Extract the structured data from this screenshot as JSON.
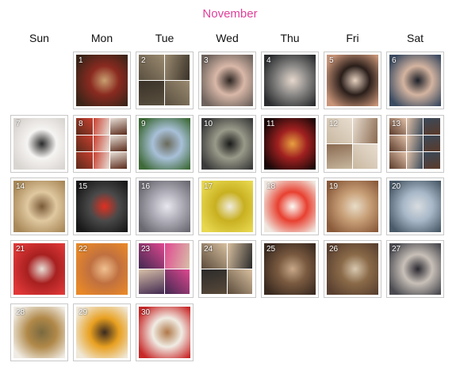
{
  "month_title": "November",
  "weekdays": [
    "Sun",
    "Mon",
    "Tue",
    "Wed",
    "Thu",
    "Fri",
    "Sat"
  ],
  "days": [
    {
      "n": "1",
      "icon": "christmas-decor-photo",
      "colors": [
        "#3b2418",
        "#8a2a20",
        "#c9a070"
      ]
    },
    {
      "n": "2",
      "icon": "photo-collage",
      "colors": [
        "#5a5040",
        "#9a8a70",
        "#3a3228"
      ],
      "grid": 2
    },
    {
      "n": "3",
      "icon": "selfie-photo",
      "colors": [
        "#6d625c",
        "#d9b8a8",
        "#2e2622"
      ]
    },
    {
      "n": "4",
      "icon": "car-selfie-photo",
      "colors": [
        "#2a2c2e",
        "#8c8a88",
        "#e6d8cc"
      ]
    },
    {
      "n": "5",
      "icon": "friends-sunglasses-photo",
      "colors": [
        "#c89478",
        "#2a1e1a",
        "#e8d2c0"
      ]
    },
    {
      "n": "6",
      "icon": "selfie-photo",
      "colors": [
        "#3a4a60",
        "#d4b4a0",
        "#1c2028"
      ]
    },
    {
      "n": "7",
      "icon": "penguin-cake-photo",
      "colors": [
        "#d8d4d0",
        "#f6f4f2",
        "#2a2a2a"
      ]
    },
    {
      "n": "8",
      "icon": "photo-collage",
      "colors": [
        "#5a2a1a",
        "#c84030",
        "#e8e0d8"
      ],
      "grid": 3
    },
    {
      "n": "9",
      "icon": "street-trees-photo",
      "colors": [
        "#3e6a38",
        "#a8c0d8",
        "#6a6a5a"
      ]
    },
    {
      "n": "10",
      "icon": "building-person-photo",
      "colors": [
        "#3a3a3a",
        "#9a9a8a",
        "#1a1a1a"
      ]
    },
    {
      "n": "11",
      "icon": "stage-theater-photo",
      "colors": [
        "#1a0808",
        "#a02020",
        "#e8a040"
      ]
    },
    {
      "n": "12",
      "icon": "room-interior-photo",
      "colors": [
        "#c8b8a0",
        "#e8ddd0",
        "#8a6a50"
      ],
      "grid": 2
    },
    {
      "n": "13",
      "icon": "photo-collage",
      "colors": [
        "#5a3a2a",
        "#e0c0a8",
        "#3a4a5a"
      ],
      "grid": 3
    },
    {
      "n": "14",
      "icon": "dog-photo",
      "colors": [
        "#a88858",
        "#e0c8a0",
        "#7a5a38"
      ]
    },
    {
      "n": "15",
      "icon": "car-dashboard-photo",
      "colors": [
        "#181818",
        "#4a4a4a",
        "#e03020"
      ]
    },
    {
      "n": "16",
      "icon": "hotel-sign-photo",
      "colors": [
        "#6a6870",
        "#b0aeb8",
        "#e8e6ee"
      ]
    },
    {
      "n": "17",
      "icon": "food-bowl-photo",
      "colors": [
        "#e8d850",
        "#c8b020",
        "#f0ece0"
      ]
    },
    {
      "n": "18",
      "icon": "dessert-plate-photo",
      "colors": [
        "#f0e8e0",
        "#e84030",
        "#fbfaf6"
      ]
    },
    {
      "n": "19",
      "icon": "dinner-table-photo",
      "colors": [
        "#8a5a3a",
        "#c8a078",
        "#e8dcc8"
      ]
    },
    {
      "n": "20",
      "icon": "window-photo",
      "colors": [
        "#4a5a68",
        "#a8b8c8",
        "#d8dce0"
      ]
    },
    {
      "n": "21",
      "icon": "plated-food-photo",
      "colors": [
        "#e03838",
        "#a82020",
        "#e8e0d8"
      ]
    },
    {
      "n": "22",
      "icon": "selfie-photo",
      "colors": [
        "#e88828",
        "#c07040",
        "#f0c090"
      ]
    },
    {
      "n": "23",
      "icon": "photo-collage",
      "colors": [
        "#402850",
        "#e04890",
        "#d8c0a8"
      ],
      "grid": 2
    },
    {
      "n": "24",
      "icon": "dog-photo",
      "colors": [
        "#5a4a3a",
        "#d8c0a0",
        "#2a2a2a"
      ],
      "grid": 2
    },
    {
      "n": "25",
      "icon": "fireplace-room-photo",
      "colors": [
        "#3a2a20",
        "#7a5a40",
        "#c8a888"
      ]
    },
    {
      "n": "26",
      "icon": "dining-room-photo",
      "colors": [
        "#5a4030",
        "#8a6a48",
        "#d8c8b0"
      ]
    },
    {
      "n": "27",
      "icon": "group-photo",
      "colors": [
        "#4a4a50",
        "#c8c0b8",
        "#2a2830"
      ]
    },
    {
      "n": "28",
      "icon": "food-plate-photo",
      "colors": [
        "#f0ece4",
        "#b08848",
        "#7a6a40"
      ]
    },
    {
      "n": "29",
      "icon": "coffee-bag-photo",
      "colors": [
        "#f0e8d8",
        "#e8a020",
        "#3a2a20"
      ]
    },
    {
      "n": "30",
      "icon": "dessert-plate-photo",
      "colors": [
        "#c82828",
        "#f0ece4",
        "#b07848"
      ]
    }
  ],
  "start_weekday": 1
}
